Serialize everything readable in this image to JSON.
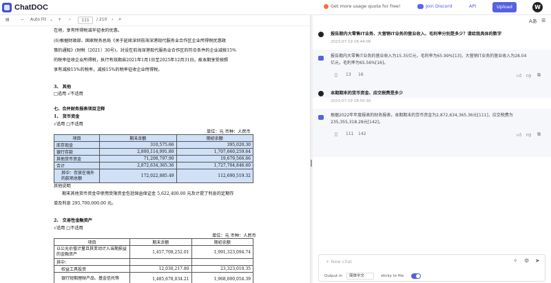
{
  "app": {
    "name": "ChatDOC"
  },
  "topbar": {
    "quota_text": "Get more usage quota for free!",
    "discord_label": "Join Discord",
    "api_label": "API",
    "upload_label": "Upload",
    "avatar_initial": "W"
  },
  "doc_toolbar": {
    "zoom": "Auto Fit",
    "page_current": "111",
    "page_total": "/ 210"
  },
  "document": {
    "line1": "在地，享有所得税减半征收的优惠。",
    "line2": "(6)根据财政部、国家税务总局《关于延续深圳前海深港现代服务业合作区企业所得税优惠政",
    "line3": "策的通知》(财税〔2021〕30号)，对设在前海深港现代服务业合作区的符合条件的企业减按15%",
    "line4": "的税率征收企业所得税，执行有效期自2021年1月1日至2025年12月31日。故本期享受按照",
    "line5": "享有减按15%的税率，减按15%的税率征收企业所得税。",
    "sec3": "3、 其他",
    "sec3_opt": "□适用  √不适用",
    "sec7": "七、合并财务报表项目注释",
    "sec7_1": "1、 货币资金",
    "sec7_1_opt": "√适用  □不适用",
    "unit1": "单位：元   币种：人民币",
    "table1": {
      "headers": [
        "项目",
        "期末余额",
        "期初余额"
      ],
      "rows": [
        [
          "库存现金",
          "310,575.66",
          "395,020.30"
        ],
        [
          "银行存款",
          "2,800,114,991.80",
          "1,707,660,259.64"
        ],
        [
          "其他货币资金",
          "71,208,797.90",
          "19,679,566.66"
        ],
        [
          "合计",
          "2,872,634,365.36",
          "1,727,704,846.60"
        ],
        [
          "其中：存放在境外的款项总额",
          "172,022,885.49",
          "112,690,519.32"
        ]
      ]
    },
    "note_title": "其他说明",
    "note_line1": "期末其他货币资金中使用受限资金包括保函保证金 5,622,400.00 元及计提了利息的定期存",
    "note_line2": "单及利息 295,700,000.00 元。",
    "sec7_2": "2、 交易性金融资产",
    "sec7_2_opt": "√适用  □不适用",
    "unit2": "单位：元   币种：人民币",
    "table2": {
      "headers": [
        "项目",
        "期末余额",
        "期初余额"
      ],
      "rows": [
        [
          "以公允价值计量且其变动计入当期损益的金融资产",
          "1,457,708,252.01",
          "1,991,323,094.74"
        ],
        [
          "其中：",
          "",
          ""
        ],
        [
          "权益工具投资",
          "12,030,217.80",
          "23,323,010.35"
        ],
        [
          "银行短期理财产品、基金信托等",
          "1,485,678,034.21",
          "1,968,000,054.39"
        ]
      ]
    }
  },
  "chat": {
    "messages": [
      {
        "question": "报告期内大零售IT业务、大营销IT业务的营业收入、毛利率分别是多少？请给我具体的数字",
        "time": "2023-07-19 18:44:08",
        "answer_line1": "报告期内大零售IT业务的营业收入为15.35亿元，毛利率为65.99%[13]，大营销IT业务的营业收入为28.04",
        "answer_line2": "亿元，毛利率为65.56%[16]。",
        "refs": [
          "13",
          "16"
        ]
      },
      {
        "question": "本期期末的货币资金、应交税费是多少",
        "time": "2023-07-19 18:50:30",
        "answer_line1": "根据2022年年度报表的财务报表，本期期末的货币资金为2,872,634,365.36元[111]，应交税费为",
        "answer_line2": "235,355,318.28元[142]。",
        "refs": [
          "111",
          "142"
        ]
      }
    ],
    "input_placeholder": "+ New chat",
    "output_in_label": "Output in",
    "output_lang": "简体中文",
    "sticky_label": "sticky to file"
  },
  "colors": {
    "accent": "#5561e0",
    "highlight": "#cfe0f7"
  }
}
